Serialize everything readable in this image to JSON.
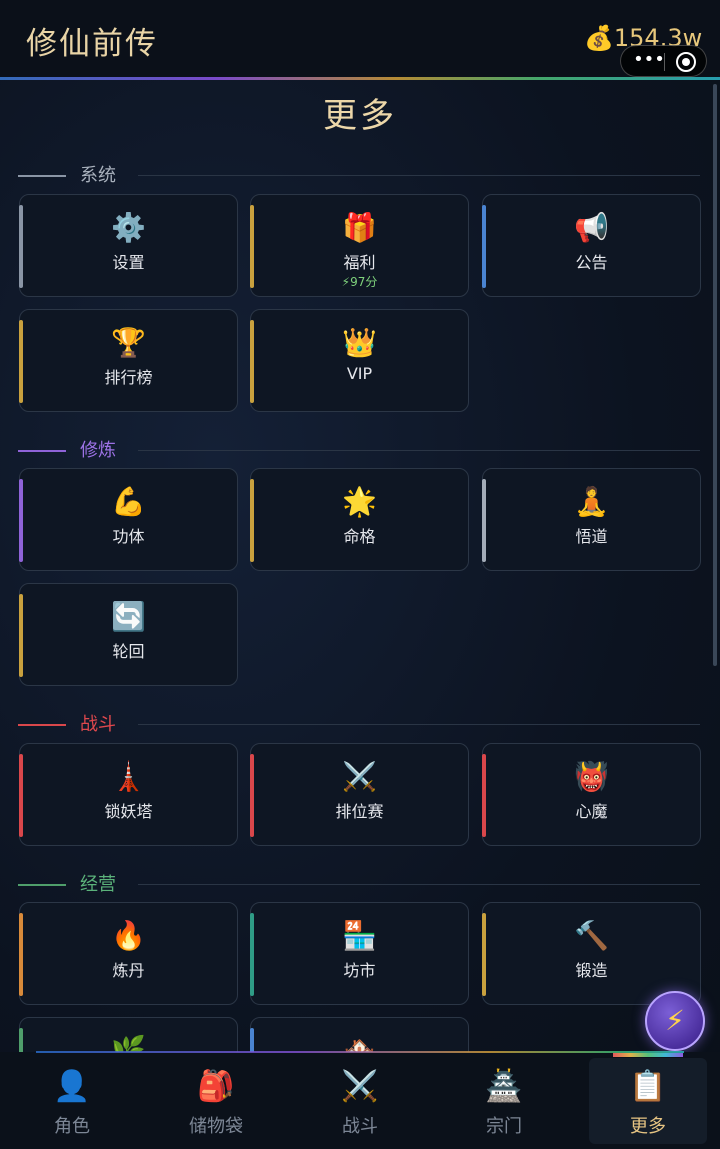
{
  "header": {
    "app_title": "修仙前传",
    "currency_icon": "money-bag-icon",
    "currency_value": "154.3w",
    "capsule_more": "•••"
  },
  "page": {
    "title": "更多"
  },
  "colors": {
    "system": "#8a95a5",
    "cultivate": "#8f63d8",
    "battle": "#d9474b",
    "business": "#4f9e6b",
    "gold": "#c9a13e",
    "blue": "#4a84d1",
    "grey": "#a3acb8",
    "orange": "#d88a3a",
    "teal": "#2f9c86"
  },
  "sections": {
    "system": {
      "label": "系统",
      "items": [
        {
          "icon": "⚙️",
          "icon_name": "gear-icon",
          "label": "设置",
          "sub": ""
        },
        {
          "icon": "🎁",
          "icon_name": "gift-icon",
          "label": "福利",
          "sub": "⚡97分"
        },
        {
          "icon": "📢",
          "icon_name": "megaphone-icon",
          "label": "公告",
          "sub": ""
        },
        {
          "icon": "🏆",
          "icon_name": "trophy-icon",
          "label": "排行榜",
          "sub": ""
        },
        {
          "icon": "👑",
          "icon_name": "crown-icon",
          "label": "VIP",
          "sub": ""
        }
      ]
    },
    "cultivate": {
      "label": "修炼",
      "items": [
        {
          "icon": "💪",
          "icon_name": "muscle-icon",
          "label": "功体"
        },
        {
          "icon": "🌟",
          "icon_name": "star-icon",
          "label": "命格"
        },
        {
          "icon": "🧘",
          "icon_name": "meditation-icon",
          "label": "悟道"
        },
        {
          "icon": "🔄",
          "icon_name": "cycle-icon",
          "label": "轮回"
        }
      ]
    },
    "battle": {
      "label": "战斗",
      "items": [
        {
          "icon": "🗼",
          "icon_name": "tower-icon",
          "label": "锁妖塔"
        },
        {
          "icon": "⚔️",
          "icon_name": "crossed-swords-icon",
          "label": "排位赛"
        },
        {
          "icon": "👹",
          "icon_name": "demon-icon",
          "label": "心魔"
        }
      ]
    },
    "business": {
      "label": "经营",
      "items": [
        {
          "icon": "🔥",
          "icon_name": "fire-icon",
          "label": "炼丹"
        },
        {
          "icon": "🏪",
          "icon_name": "market-icon",
          "label": "坊市"
        },
        {
          "icon": "🔨",
          "icon_name": "hammer-icon",
          "label": "锻造"
        },
        {
          "icon": "🌿",
          "icon_name": "herb-icon",
          "label": ""
        },
        {
          "icon": "🏘️",
          "icon_name": "houses-icon",
          "label": ""
        }
      ]
    }
  },
  "fab": {
    "icon": "⚡",
    "icon_name": "lightning-icon"
  },
  "nav": [
    {
      "icon": "👤",
      "icon_name": "character-icon",
      "label": "角色"
    },
    {
      "icon": "🎒",
      "icon_name": "backpack-icon",
      "label": "储物袋"
    },
    {
      "icon": "⚔️",
      "icon_name": "crossed-swords-icon",
      "label": "战斗"
    },
    {
      "icon": "🏯",
      "icon_name": "pagoda-icon",
      "label": "宗门"
    },
    {
      "icon": "📋",
      "icon_name": "clipboard-icon",
      "label": "更多"
    }
  ]
}
